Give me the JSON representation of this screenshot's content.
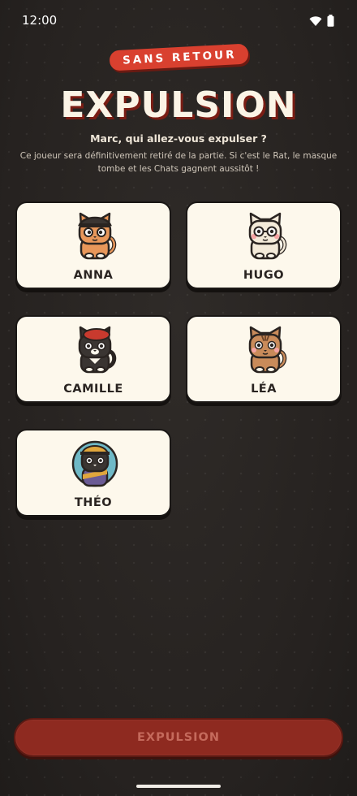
{
  "status_bar": {
    "time": "12:00",
    "wifi_icon": "wifi-icon",
    "battery_icon": "battery-icon"
  },
  "header": {
    "badge": "SANS RETOUR",
    "title": "EXPULSION",
    "question": "Marc, qui allez-vous expulser ?",
    "description": "Ce joueur sera définitivement retiré de la partie. Si c'est le Rat, le masque tombe et les Chats gagnent aussitôt !"
  },
  "players": [
    {
      "name": "ANNA",
      "avatar": "cat-orange-beanie-avatar"
    },
    {
      "name": "HUGO",
      "avatar": "cat-white-glasses-avatar"
    },
    {
      "name": "CAMILLE",
      "avatar": "cat-black-beret-avatar"
    },
    {
      "name": "LÉA",
      "avatar": "cat-tabby-avatar"
    },
    {
      "name": "THÉO",
      "avatar": "cat-black-cap-avatar"
    }
  ],
  "action": {
    "expel_label": "EXPULSION"
  },
  "colors": {
    "accent": "#d9402f",
    "button": "#8e2a20",
    "card": "#fdf8ec",
    "background": "#2e2a27"
  }
}
